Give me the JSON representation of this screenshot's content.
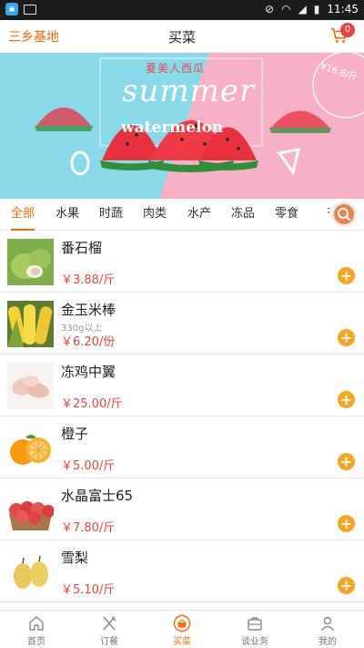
{
  "status_bar": {
    "time": "11:45"
  },
  "header": {
    "base_label": "三乡基地",
    "title": "买菜",
    "cart_count": "0"
  },
  "banner": {
    "cn_text": "夏美人西瓜",
    "headline": "summer",
    "subline": "watermelon",
    "price_tag": "¥16.8/斤"
  },
  "tabs": [
    {
      "label": "全部",
      "active": true
    },
    {
      "label": "水果"
    },
    {
      "label": "时蔬"
    },
    {
      "label": "肉类"
    },
    {
      "label": "水产"
    },
    {
      "label": "冻品"
    },
    {
      "label": "零食"
    },
    {
      "label": "干"
    }
  ],
  "products": [
    {
      "name": "番石榴",
      "note": "",
      "price": "￥3.88/斤",
      "icon": "guava-image"
    },
    {
      "name": "金玉米棒",
      "note": "330g以上",
      "price": "￥6.20/份",
      "icon": "corn-image"
    },
    {
      "name": "冻鸡中翼",
      "note": "",
      "price": "￥25.00/斤",
      "icon": "chicken-wing-image"
    },
    {
      "name": "橙子",
      "note": "",
      "price": "￥5.00/斤",
      "icon": "orange-image"
    },
    {
      "name": "水晶富士65",
      "note": "",
      "price": "￥7.80/斤",
      "icon": "apple-image"
    },
    {
      "name": "雪梨",
      "note": "",
      "price": "￥5.10/斤",
      "icon": "pear-image"
    }
  ],
  "add_label": "+",
  "nav": [
    {
      "label": "首页",
      "icon": "home-icon"
    },
    {
      "label": "订餐",
      "icon": "fork-knife-icon"
    },
    {
      "label": "买菜",
      "icon": "basket-icon",
      "active": true
    },
    {
      "label": "谈业务",
      "icon": "briefcase-icon"
    },
    {
      "label": "我的",
      "icon": "person-icon"
    }
  ],
  "colors": {
    "accent": "#ff6a00",
    "price": "#e84343",
    "add": "#f5a623"
  }
}
